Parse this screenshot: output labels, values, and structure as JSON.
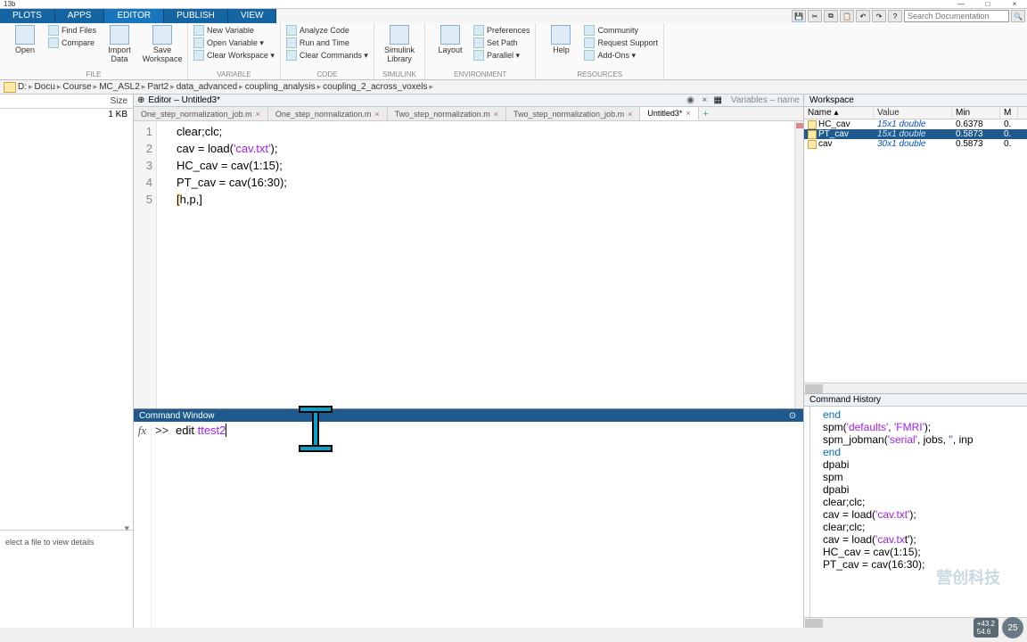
{
  "window": {
    "title": "13b",
    "min": "—",
    "max": "□",
    "close": "×"
  },
  "tabs": {
    "plots": "PLOTS",
    "apps": "APPS",
    "editor": "EDITOR",
    "publish": "PUBLISH",
    "view": "VIEW"
  },
  "search": {
    "placeholder": "Search Documentation"
  },
  "ribbon": {
    "file": {
      "group": "FILE",
      "open": "Open",
      "compare": "Compare",
      "findfiles": "Find Files",
      "import": "Import Data",
      "save": "Save Workspace"
    },
    "variable": {
      "group": "VARIABLE",
      "newvar": "New Variable",
      "openvar": "Open Variable ▾",
      "clearws": "Clear Workspace ▾"
    },
    "code": {
      "group": "CODE",
      "analyze": "Analyze Code",
      "runtime": "Run and Time",
      "clearcmd": "Clear Commands ▾"
    },
    "simulink": {
      "group": "SIMULINK",
      "lib": "Simulink Library"
    },
    "env": {
      "group": "ENVIRONMENT",
      "layout": "Layout",
      "prefs": "Preferences",
      "setpath": "Set Path",
      "parallel": "Parallel ▾"
    },
    "res": {
      "group": "RESOURCES",
      "help": "Help",
      "community": "Community",
      "support": "Request Support",
      "addons": "Add-Ons ▾"
    }
  },
  "breadcrumb": [
    "D:",
    "Docu",
    "Course",
    "MC_ASL2",
    "Part2",
    "data_advanced",
    "coupling_analysis",
    "coupling_2_across_voxels"
  ],
  "currentfolder": {
    "size_hdr": "Size",
    "row_size": "1 KB",
    "details": "elect a file to view details"
  },
  "editor": {
    "title": "Editor – Untitled3*",
    "vars_title": "Variables – name",
    "tabs": [
      {
        "label": "One_step_normalization_job.m",
        "active": false
      },
      {
        "label": "One_step_normalization.m",
        "active": false
      },
      {
        "label": "Two_step_normalization.m",
        "active": false
      },
      {
        "label": "Two_step_normalization_job.m",
        "active": false
      },
      {
        "label": "Untitled3*",
        "active": true
      }
    ],
    "code": [
      {
        "n": 1,
        "plain": "clear;clc;"
      },
      {
        "n": 2,
        "pre": "cav = load(",
        "str": "'cav.txt'",
        "post": ");"
      },
      {
        "n": 3,
        "plain": "HC_cav = cav(1:15);"
      },
      {
        "n": 4,
        "plain": "PT_cav = cav(16:30);"
      },
      {
        "n": 5,
        "hl": "[",
        "plain2": "h,p,]"
      }
    ]
  },
  "cmdwin": {
    "title": "Command Window",
    "prompt": ">>",
    "cmd_pre": "edit ",
    "cmd_arg": "ttest2"
  },
  "workspace": {
    "title": "Workspace",
    "cols": {
      "name": "Name ▴",
      "value": "Value",
      "min": "Min",
      "max": "M"
    },
    "rows": [
      {
        "name": "HC_cav",
        "value": "15x1 double",
        "min": "0.6378",
        "max": "0.",
        "sel": false
      },
      {
        "name": "PT_cav",
        "value": "15x1 double",
        "min": "0.5873",
        "max": "0.",
        "sel": true
      },
      {
        "name": "cav",
        "value": "30x1 double",
        "min": "0.5873",
        "max": "0.",
        "sel": false
      }
    ]
  },
  "history": {
    "title": "Command History",
    "lines": [
      {
        "kw": "end"
      },
      {
        "t": "spm(",
        "s": "'defaults'",
        "t2": ", ",
        "s2": "'FMRI'",
        "t3": ");"
      },
      {
        "t": "spm_jobman(",
        "s": "'serial'",
        "t2": ", jobs, ",
        "s2": "''",
        "t3": ", inp"
      },
      {
        "kw": "end"
      },
      {
        "t": "dpabi"
      },
      {
        "t": "spm"
      },
      {
        "t": "dpabi"
      },
      {
        "t": "clear;clc;"
      },
      {
        "t": "cav = load(",
        "s": "'cav.txt'",
        "t2": ");"
      },
      {
        "t": "clear;clc;"
      },
      {
        "t": "cav = load(",
        "s": "'cav.tx",
        "t2": "t');"
      },
      {
        "t": "HC_cav = cav(1:15);"
      },
      {
        "t": "PT_cav = cav(16:30);"
      }
    ]
  },
  "overlay": {
    "b1a": "+43.2",
    "b1b": "54.6",
    "b2": "25",
    "watermark": "营创科技"
  }
}
